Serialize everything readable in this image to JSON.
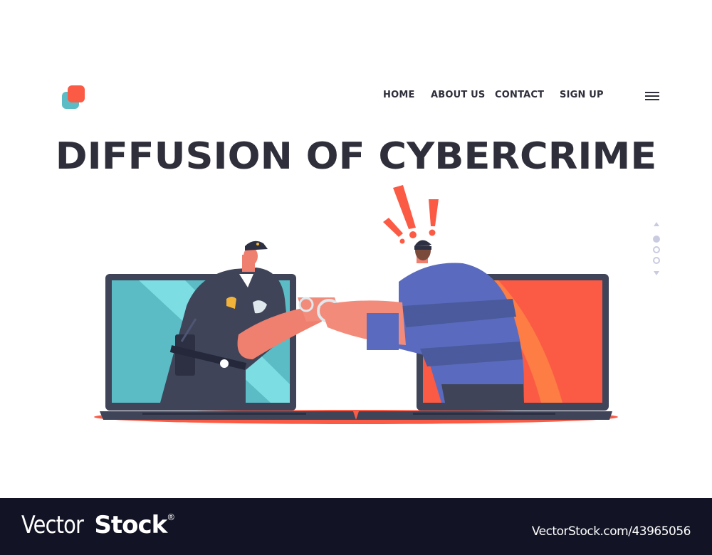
{
  "header": {
    "logo_icon": "stacked-squares-logo",
    "nav": [
      {
        "label": "HOME"
      },
      {
        "label": "ABOUT US"
      },
      {
        "label": "CONTACT"
      },
      {
        "label": "SIGN UP"
      }
    ],
    "menu_icon": "hamburger-menu-icon"
  },
  "hero": {
    "title": "DIFFUSION OF CYBERCRIME",
    "illustration": "Police officer emerging from a teal laptop screen handcuffing a masked thief emerging from a red laptop screen, with red exclamation marks above the thief"
  },
  "pager": {
    "total": 3,
    "active_index": 0
  },
  "colors": {
    "text_dark": "#2f2f3b",
    "accent_red": "#fb5b45",
    "accent_teal": "#5bbcc6",
    "pager": "#c9cbe0",
    "footer_bg": "#121425"
  },
  "footer": {
    "brand_light": "Vector",
    "brand_bold": "Stock",
    "brand_mark": "®",
    "reference": "VectorStock.com/43965056"
  }
}
